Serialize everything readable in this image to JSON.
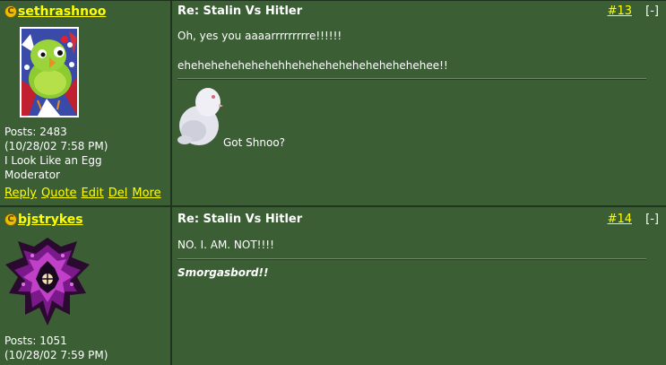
{
  "posts": [
    {
      "username": "sethrashnoo",
      "posts_label": "Posts: 2483",
      "date": "(10/28/02 7:58 PM)",
      "user_title_line1": "I Look Like an Egg",
      "user_title_line2": "Moderator",
      "actions": [
        "Reply",
        "Quote",
        "Edit",
        "Del",
        "More"
      ],
      "subject": "Re: Stalin Vs Hitler",
      "number": "#13",
      "collapse": "[-]",
      "line1": "Oh, yes you aaaarrrrrrrrre!!!!!!",
      "line2": "ehehehehehehehehhehehehehehehehehehehee!!",
      "signature": "Got Shnoo?"
    },
    {
      "username": "bjstrykes",
      "posts_label": "Posts: 1051",
      "date": "(10/28/02 7:59 PM)",
      "subject": "Re: Stalin Vs Hitler",
      "number": "#14",
      "collapse": "[-]",
      "line1": "NO. I. AM. NOT!!!!",
      "signature": "Smorgasbord!!"
    }
  ],
  "colors": {
    "background": "#3b5e35",
    "border": "#1e341e",
    "link": "#ffff00",
    "text": "#ffffff"
  },
  "icons": [
    "online-status-icon",
    "bird-avatar",
    "dark-emblem-avatar",
    "shnoo-bird-image"
  ]
}
